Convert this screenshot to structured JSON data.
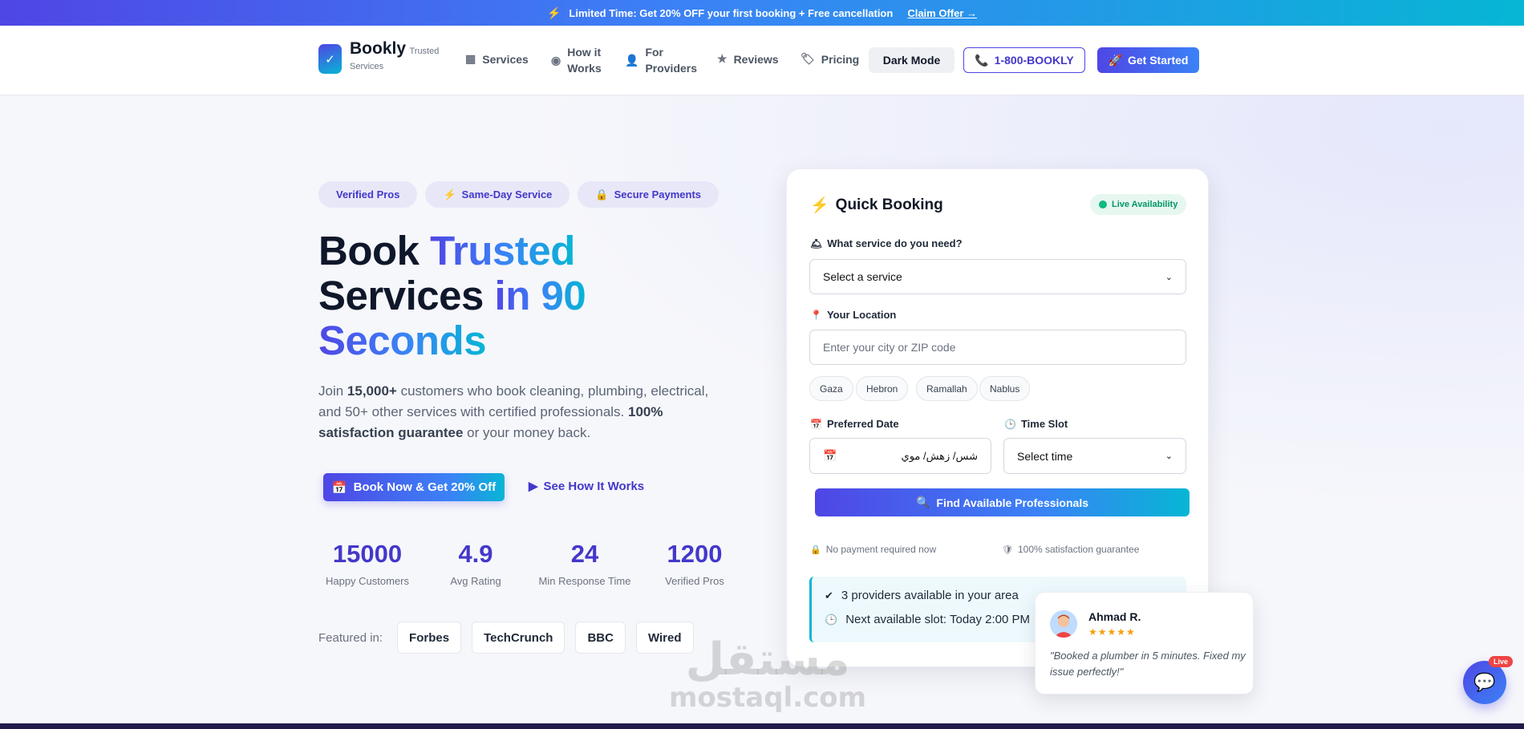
{
  "promo": {
    "text": "Limited Time: Get 20% OFF your first booking + Free cancellation",
    "claim": "Claim Offer",
    "claim_arrow": "→"
  },
  "nav": {
    "brand": "Bookly",
    "tagline_a": "Trusted",
    "tagline_b": "Services",
    "links": [
      {
        "label": "Services",
        "icon": "grid-icon"
      },
      {
        "label_a": "How it",
        "label_b": "Works",
        "icon": "play-circle-icon"
      },
      {
        "label_a": "For",
        "label_b": "Providers",
        "icon": "user-check-icon"
      },
      {
        "label": "Reviews",
        "icon": "star-icon"
      },
      {
        "label": "Pricing",
        "icon": "tag-icon"
      }
    ],
    "dark_mode": "Dark Mode",
    "phone": "1-800-BOOKLY",
    "get_started": "Get Started"
  },
  "hero": {
    "pills": [
      "Verified Pros",
      "Same-Day Service",
      "Secure Payments"
    ],
    "headline": {
      "w1": "Book",
      "w2": "Trusted",
      "w3": "Services",
      "w4": "in 90",
      "w5": "Seconds"
    },
    "lede": {
      "p1": "Join ",
      "b1": "15,000+",
      "p2": " customers who book cleaning, plumbing, electrical, and 50+ other services with certified professionals. ",
      "b2": "100% satisfaction guarantee",
      "p3": " or your money back."
    },
    "cta": "Book Now & Get 20% Off",
    "how": "See How It Works",
    "stats": [
      {
        "value": "15000",
        "label": "Happy Customers"
      },
      {
        "value": "4.9",
        "label": "Avg Rating"
      },
      {
        "value": "24",
        "label": "Min Response Time"
      },
      {
        "value": "1200",
        "label": "Verified Pros"
      }
    ],
    "featured_label": "Featured in:",
    "featured": [
      "Forbes",
      "TechCrunch",
      "BBC",
      "Wired"
    ]
  },
  "booking": {
    "title": "Quick Booking",
    "live": "Live Availability",
    "service_label": "What service do you need?",
    "service_value": "Select a service",
    "location_label": "Your Location",
    "location_placeholder": "Enter your city or ZIP code",
    "cities": [
      "Gaza",
      "Hebron",
      "Ramallah",
      "Nablus"
    ],
    "date_label": "Preferred Date",
    "date_value": "شس/ زهش/ موي",
    "time_label": "Time Slot",
    "time_value": "Select time",
    "find": "Find Available Professionals",
    "note1": "No payment required now",
    "note2": "100% satisfaction guarantee",
    "avail1": "3 providers available in your area",
    "avail2": "Next available slot: Today 2:00 PM"
  },
  "review": {
    "name": "Ahmad R.",
    "stars": "★★★★★",
    "rating": 5,
    "text": "\"Booked a plumber in 5 minutes. Fixed my issue perfectly!\""
  },
  "watermark": {
    "ar": "مستقل",
    "en": "mostaql.com"
  },
  "chat": {
    "live": "Live"
  },
  "colors": {
    "primary": "#4f46e5",
    "accent": "#06b6d4",
    "success": "#10b981",
    "star": "#f59e0b"
  }
}
